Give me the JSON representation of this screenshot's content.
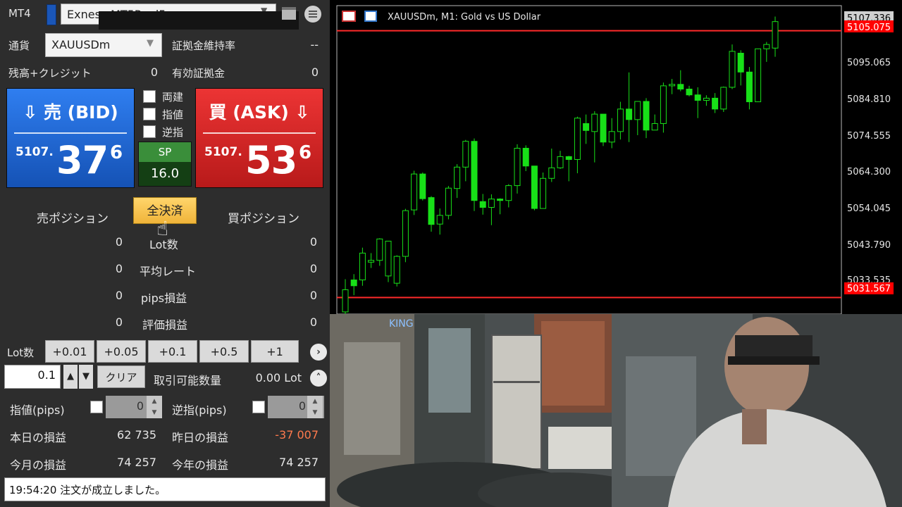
{
  "panel": {
    "app_label": "MT4",
    "account": "Exness-MT5Real5",
    "currency_label": "通貨",
    "symbol": "XAUUSDm",
    "margin_level_label": "証拠金維持率",
    "margin_level_value": "--",
    "balance_label": "残高+クレジット",
    "balance_value": "0",
    "margin_label": "有効証拠金",
    "margin_value": "0",
    "bid": {
      "title": "⇩ 売 (BID)",
      "prefix": "5107.",
      "big": "37",
      "sup": "6"
    },
    "ask": {
      "title": "買 (ASK) ⇩",
      "prefix": "5107.",
      "big": "53",
      "sup": "6"
    },
    "hedge_label": "両建",
    "limit_label": "指値",
    "stop_label": "逆指",
    "sp_label": "SP",
    "sp_value": "16.0",
    "sell_positions_label": "売ポジション",
    "close_all_label": "全決済",
    "buy_positions_label": "買ポジション",
    "stats": [
      {
        "label": "Lot数",
        "sell": "0",
        "buy": "0"
      },
      {
        "label": "平均レート",
        "sell": "0",
        "buy": "0"
      },
      {
        "label": "pips損益",
        "sell": "0",
        "buy": "0"
      },
      {
        "label": "評価損益",
        "sell": "0",
        "buy": "0"
      }
    ],
    "lot_label": "Lot数",
    "lot_buttons": [
      "+0.01",
      "+0.05",
      "+0.1",
      "+0.5",
      "+1"
    ],
    "lot_value": "0.1",
    "clear_label": "クリア",
    "tradable_label": "取引可能数量",
    "tradable_value": "0.00 Lot",
    "limit_pips_label": "指値(pips)",
    "limit_pips_value": "0",
    "stop_pips_label": "逆指(pips)",
    "stop_pips_value": "0",
    "today_pl_label": "本日の損益",
    "today_pl_value": "62 735",
    "yesterday_pl_label": "昨日の損益",
    "yesterday_pl_value": "-37 007",
    "month_pl_label": "今月の損益",
    "month_pl_value": "74 257",
    "year_pl_label": "今年の損益",
    "year_pl_value": "74 257",
    "status_message": "19:54:20 注文が成立しました。"
  },
  "chart": {
    "title": "XAUUSDm, M1:  Gold vs US Dollar",
    "price_labels": [
      "5095.065",
      "5084.810",
      "5074.555",
      "5064.300",
      "5054.045",
      "5043.790"
    ],
    "top_price_label": "5107.336",
    "ask_line_label": "5105.075",
    "partial_label": "5033.535",
    "low_line_label": "5031.567",
    "line_color": "#ff2a2a",
    "candle_color": "#18e018"
  },
  "chart_data": {
    "type": "candlestick",
    "title": "XAUUSDm, M1:  Gold vs US Dollar",
    "y_ticks": [
      5033.535,
      5043.79,
      5054.045,
      5064.3,
      5074.555,
      5084.81,
      5095.065,
      5107.336
    ],
    "y_range": [
      5027,
      5112
    ],
    "horizontal_lines": [
      5105.075,
      5031.567
    ],
    "candles": [
      {
        "o": 5027.6,
        "h": 5036.6,
        "l": 5026.4,
        "c": 5033.7
      },
      {
        "o": 5036.4,
        "h": 5038.0,
        "l": 5032.2,
        "c": 5034.8
      },
      {
        "o": 5036.4,
        "h": 5045.3,
        "l": 5034.8,
        "c": 5043.8
      },
      {
        "o": 5041.3,
        "h": 5043.8,
        "l": 5039.7,
        "c": 5041.8
      },
      {
        "o": 5041.8,
        "h": 5047.9,
        "l": 5040.3,
        "c": 5047.7
      },
      {
        "o": 5037.5,
        "h": 5047.1,
        "l": 5035.8,
        "c": 5047.1
      },
      {
        "o": 5035.5,
        "h": 5043.2,
        "l": 5034.6,
        "c": 5042.9
      },
      {
        "o": 5042.9,
        "h": 5056.0,
        "l": 5041.3,
        "c": 5055.5
      },
      {
        "o": 5055.7,
        "h": 5066.5,
        "l": 5054.3,
        "c": 5065.6
      },
      {
        "o": 5065.6,
        "h": 5066.0,
        "l": 5058.3,
        "c": 5058.8
      },
      {
        "o": 5059.1,
        "h": 5059.5,
        "l": 5049.7,
        "c": 5051.7
      },
      {
        "o": 5051.8,
        "h": 5056.1,
        "l": 5048.9,
        "c": 5054.2
      },
      {
        "o": 5054.2,
        "h": 5062.3,
        "l": 5053.1,
        "c": 5061.7
      },
      {
        "o": 5061.6,
        "h": 5068.3,
        "l": 5059.0,
        "c": 5067.5
      },
      {
        "o": 5067.5,
        "h": 5075.0,
        "l": 5063.6,
        "c": 5074.6
      },
      {
        "o": 5074.6,
        "h": 5075.4,
        "l": 5055.4,
        "c": 5058.3
      },
      {
        "o": 5058.0,
        "h": 5060.1,
        "l": 5054.4,
        "c": 5056.4
      },
      {
        "o": 5056.4,
        "h": 5060.0,
        "l": 5051.5,
        "c": 5058.7
      },
      {
        "o": 5058.7,
        "h": 5058.9,
        "l": 5054.5,
        "c": 5058.3
      },
      {
        "o": 5058.3,
        "h": 5062.8,
        "l": 5056.4,
        "c": 5062.4
      },
      {
        "o": 5062.4,
        "h": 5073.8,
        "l": 5060.2,
        "c": 5072.7
      },
      {
        "o": 5072.7,
        "h": 5073.5,
        "l": 5066.4,
        "c": 5067.8
      },
      {
        "o": 5067.8,
        "h": 5067.8,
        "l": 5055.6,
        "c": 5056.1
      },
      {
        "o": 5056.1,
        "h": 5066.0,
        "l": 5056.1,
        "c": 5064.4
      },
      {
        "o": 5064.4,
        "h": 5072.6,
        "l": 5063.4,
        "c": 5067.3
      },
      {
        "o": 5067.3,
        "h": 5072.0,
        "l": 5067.0,
        "c": 5070.4
      },
      {
        "o": 5070.4,
        "h": 5070.6,
        "l": 5063.6,
        "c": 5069.6
      },
      {
        "o": 5069.6,
        "h": 5081.4,
        "l": 5065.8,
        "c": 5081.0
      },
      {
        "o": 5079.5,
        "h": 5082.0,
        "l": 5073.9,
        "c": 5077.6
      },
      {
        "o": 5077.3,
        "h": 5082.9,
        "l": 5068.8,
        "c": 5082.1
      },
      {
        "o": 5082.1,
        "h": 5082.1,
        "l": 5073.3,
        "c": 5074.4
      },
      {
        "o": 5074.4,
        "h": 5081.0,
        "l": 5072.7,
        "c": 5077.3
      },
      {
        "o": 5077.3,
        "h": 5085.5,
        "l": 5075.1,
        "c": 5083.5
      },
      {
        "o": 5083.5,
        "h": 5093.6,
        "l": 5074.4,
        "c": 5080.6
      },
      {
        "o": 5080.6,
        "h": 5085.6,
        "l": 5076.3,
        "c": 5085.6
      },
      {
        "o": 5085.6,
        "h": 5086.5,
        "l": 5075.5,
        "c": 5077.7
      },
      {
        "o": 5077.7,
        "h": 5082.0,
        "l": 5077.7,
        "c": 5079.5
      },
      {
        "o": 5079.5,
        "h": 5090.8,
        "l": 5077.0,
        "c": 5089.9
      },
      {
        "o": 5089.9,
        "h": 5091.8,
        "l": 5087.6,
        "c": 5090.3
      },
      {
        "o": 5090.3,
        "h": 5094.2,
        "l": 5088.4,
        "c": 5089.0
      },
      {
        "o": 5089.0,
        "h": 5089.9,
        "l": 5087.0,
        "c": 5087.4
      },
      {
        "o": 5087.4,
        "h": 5089.5,
        "l": 5081.0,
        "c": 5085.9
      },
      {
        "o": 5085.9,
        "h": 5087.3,
        "l": 5084.4,
        "c": 5086.5
      },
      {
        "o": 5086.5,
        "h": 5087.9,
        "l": 5082.4,
        "c": 5083.5
      },
      {
        "o": 5083.5,
        "h": 5089.7,
        "l": 5082.7,
        "c": 5089.5
      },
      {
        "o": 5089.5,
        "h": 5101.3,
        "l": 5089.0,
        "c": 5099.4
      },
      {
        "o": 5098.9,
        "h": 5099.7,
        "l": 5090.0,
        "c": 5093.7
      },
      {
        "o": 5093.7,
        "h": 5095.1,
        "l": 5083.4,
        "c": 5085.5
      },
      {
        "o": 5085.5,
        "h": 5100.1,
        "l": 5085.5,
        "c": 5100.1
      },
      {
        "o": 5100.1,
        "h": 5102.0,
        "l": 5096.5,
        "c": 5101.3
      },
      {
        "o": 5100.3,
        "h": 5109.0,
        "l": 5097.9,
        "c": 5107.6
      }
    ]
  }
}
